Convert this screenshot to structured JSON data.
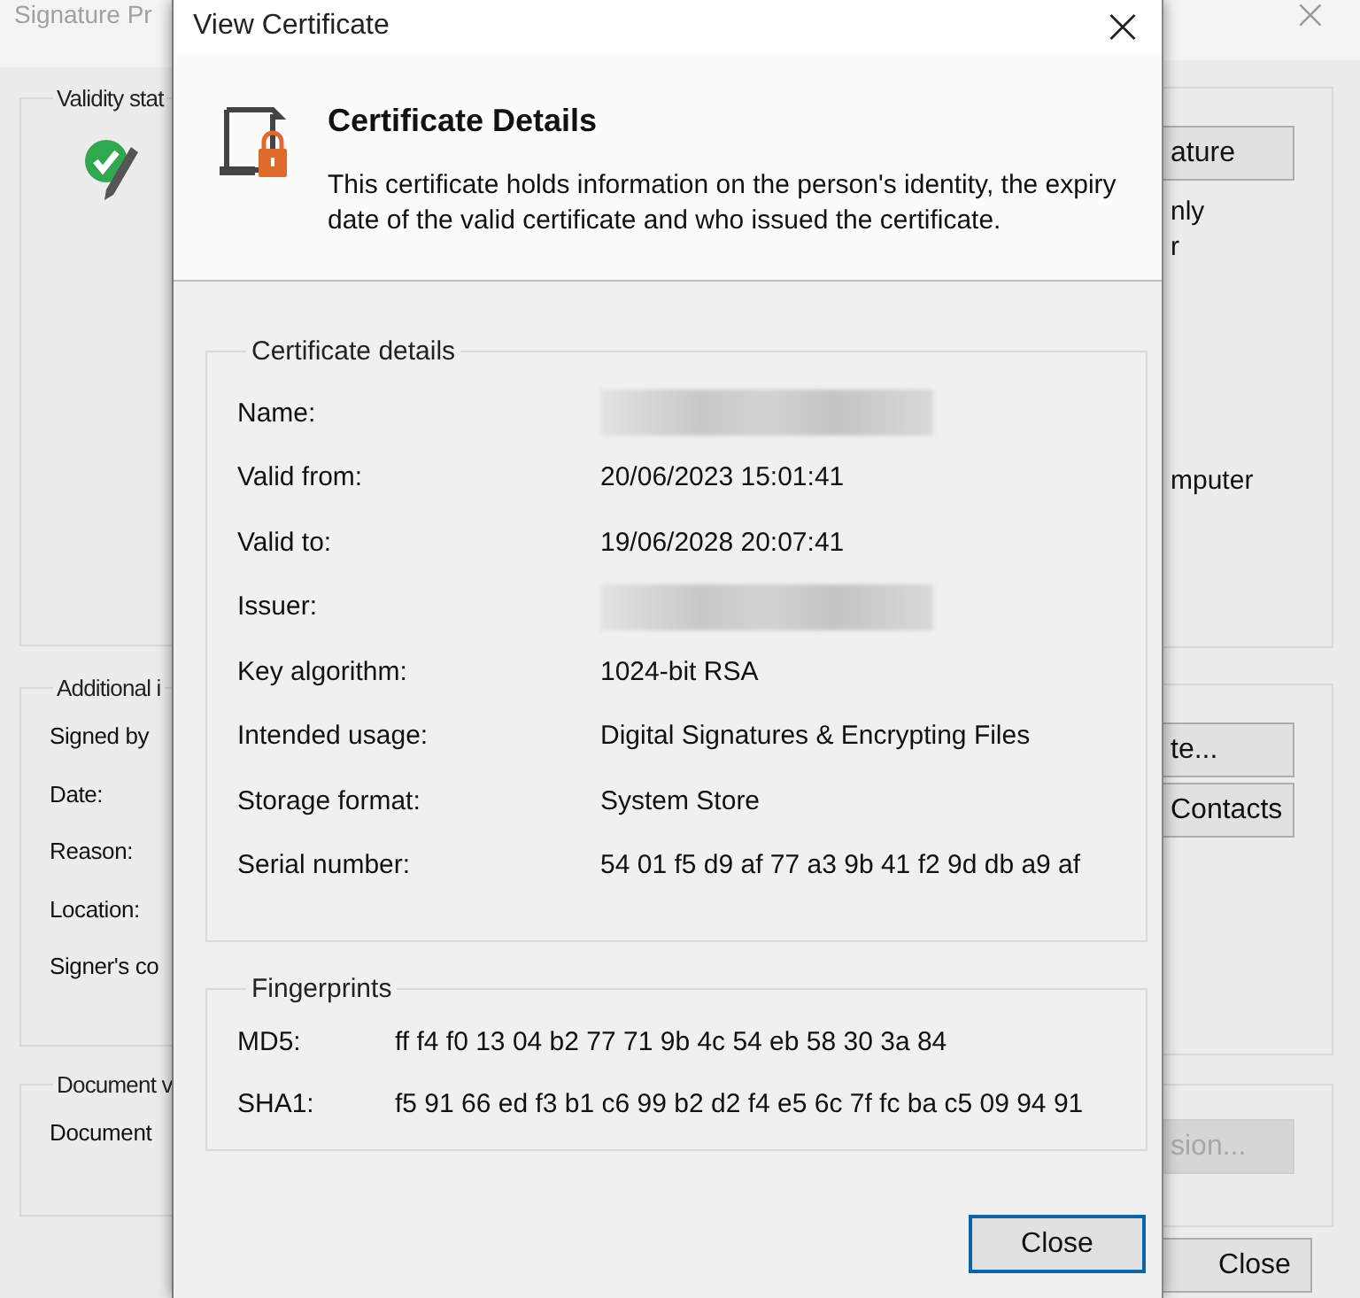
{
  "background_window": {
    "title": "Signature Pr",
    "left": {
      "groups": [
        {
          "legend": "Validity stat",
          "icon": true
        },
        {
          "legend": "Additional i",
          "labels": [
            "Signed by",
            "Date:",
            "Reason:",
            "Location:",
            "Signer's co"
          ]
        },
        {
          "legend": "Document v",
          "labels": [
            "Document"
          ]
        }
      ]
    },
    "right": {
      "groups": [
        {
          "items": [
            {
              "kind": "button",
              "text": "ature",
              "disabled": false
            },
            {
              "kind": "text",
              "text": "nly"
            },
            {
              "kind": "text",
              "text": "r"
            },
            {
              "kind": "text",
              "text": "mputer"
            }
          ]
        },
        {
          "items": [
            {
              "kind": "button",
              "text": "te...",
              "disabled": false
            },
            {
              "kind": "button",
              "text": "Contacts",
              "disabled": false
            }
          ]
        },
        {
          "items": [
            {
              "kind": "button",
              "text": "sion...",
              "disabled": true
            }
          ]
        }
      ]
    },
    "close_button": "Close"
  },
  "dialog": {
    "title": "View Certificate",
    "close": "×",
    "heading": "Certificate Details",
    "description": "This certificate holds information on the person's identity, the expiry date of the valid certificate and who issued the certificate.",
    "details": {
      "legend": "Certificate details",
      "rows": [
        {
          "label": "Name:",
          "kind": "redacted"
        },
        {
          "label": "Valid from:",
          "kind": "text",
          "value": "20/06/2023 15:01:41"
        },
        {
          "label": "Valid to:",
          "kind": "text",
          "value": "19/06/2028 20:07:41"
        },
        {
          "label": "Issuer:",
          "kind": "redacted"
        },
        {
          "label": "Key algorithm:",
          "kind": "text",
          "value": "1024-bit RSA"
        },
        {
          "label": "Intended usage:",
          "kind": "text",
          "value": "Digital Signatures & Encrypting Files"
        },
        {
          "label": "Storage format:",
          "kind": "text",
          "value": "System Store"
        },
        {
          "label": "Serial number:",
          "kind": "text",
          "value": "54 01 f5 d9 af 77 a3 9b 41 f2 9d db a9 af"
        }
      ]
    },
    "fingerprints": {
      "legend": "Fingerprints",
      "rows": [
        {
          "label": "MD5:",
          "value": "ff f4 f0 13 04 b2 77 71 9b 4c 54 eb 58 30 3a 84"
        },
        {
          "label": "SHA1:",
          "value": "f5 91 66 ed f3 b1 c6 99 b2 d2 f4 e5 6c 7f fc ba c5 09 94 91"
        }
      ]
    },
    "button": {
      "text": "Close",
      "default": true
    }
  }
}
